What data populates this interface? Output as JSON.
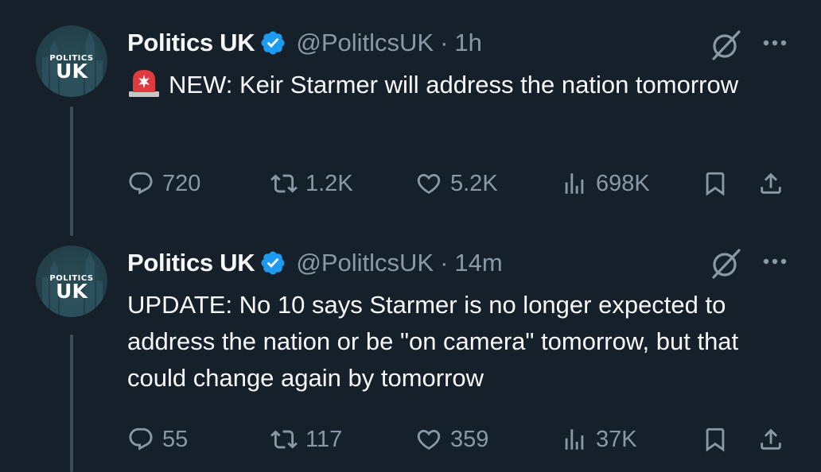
{
  "tweets": [
    {
      "avatar": {
        "top_text": "POLITICS",
        "bottom_text": "UK"
      },
      "name": "Politics UK",
      "handle": "@PolitlcsUK",
      "separator": "·",
      "time": "1h",
      "text": "NEW: Keir Starmer will address the nation tomorrow",
      "has_siren_emoji": true,
      "stats": {
        "replies": "720",
        "reposts": "1.2K",
        "likes": "5.2K",
        "views": "698K"
      }
    },
    {
      "avatar": {
        "top_text": "POLITICS",
        "bottom_text": "UK"
      },
      "name": "Politics UK",
      "handle": "@PolitlcsUK",
      "separator": "·",
      "time": "14m",
      "text": "UPDATE: No 10 says Starmer is no longer expected to address the nation or be \"on camera\" tomorrow, but that could change again by tomorrow",
      "has_siren_emoji": false,
      "stats": {
        "replies": "55",
        "reposts": "117",
        "likes": "359",
        "views": "37K"
      }
    }
  ],
  "icons": {
    "verified": "verified-badge-icon",
    "grok": "grok-icon",
    "more": "more-icon",
    "reply": "reply-icon",
    "repost": "repost-icon",
    "like": "like-icon",
    "views": "views-icon",
    "bookmark": "bookmark-icon",
    "share": "share-icon",
    "siren": "police-siren-icon"
  },
  "colors": {
    "background": "#15202b",
    "text_primary": "#f7f9f9",
    "text_secondary": "#8b98a5",
    "verified_blue": "#1d9bf0",
    "thread_line": "#3e4c5a",
    "avatar_bg": "#22404a"
  }
}
